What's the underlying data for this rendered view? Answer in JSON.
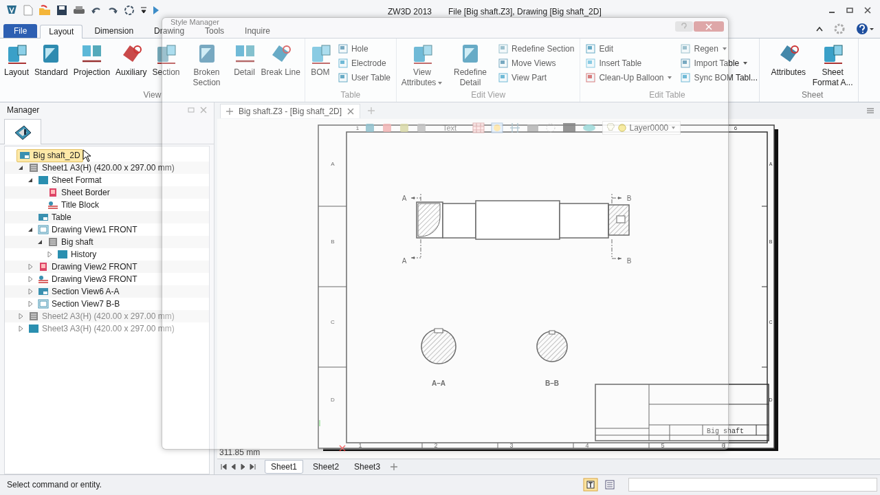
{
  "app": {
    "title": "ZW3D 2013",
    "document": "File [Big shaft.Z3],  Drawing [Big shaft_2D]"
  },
  "ribbon_tabs": [
    {
      "label": "File",
      "kind": "file",
      "selected": false
    },
    {
      "label": "Layout",
      "kind": "tab",
      "selected": true
    },
    {
      "label": "Dimension",
      "kind": "tab",
      "selected": false
    },
    {
      "label": "Drawing",
      "kind": "tab",
      "selected": false
    },
    {
      "label": "Tools",
      "kind": "tab",
      "selected": false
    },
    {
      "label": "Inquire",
      "kind": "tab",
      "selected": false
    }
  ],
  "ribbon_groups": [
    {
      "label": "View",
      "columns": [
        {
          "kind": "large",
          "items": [
            {
              "label": "Layout"
            }
          ]
        },
        {
          "kind": "large",
          "items": [
            {
              "label": "Standard"
            }
          ]
        },
        {
          "kind": "large",
          "items": [
            {
              "label": "Projection"
            }
          ]
        },
        {
          "kind": "large",
          "items": [
            {
              "label": "Auxiliary"
            }
          ]
        },
        {
          "kind": "large",
          "items": [
            {
              "label": "Section"
            }
          ]
        },
        {
          "kind": "large",
          "items": [
            {
              "label": "Broken Section"
            }
          ]
        },
        {
          "kind": "large",
          "items": [
            {
              "label": "Detail"
            }
          ]
        },
        {
          "kind": "large",
          "items": [
            {
              "label": "Break Line"
            }
          ]
        }
      ]
    },
    {
      "label": "Table",
      "columns": [
        {
          "kind": "large",
          "items": [
            {
              "label": "BOM"
            }
          ]
        },
        {
          "kind": "small",
          "items": [
            {
              "label": "Hole"
            },
            {
              "label": "Electrode"
            },
            {
              "label": "User Table"
            }
          ]
        }
      ]
    },
    {
      "label": "Edit View",
      "columns": [
        {
          "kind": "large",
          "items": [
            {
              "label": "View Attributes",
              "menu": true
            }
          ]
        },
        {
          "kind": "large",
          "items": [
            {
              "label": "Redefine Detail"
            }
          ]
        },
        {
          "kind": "small",
          "items": [
            {
              "label": "Redefine Section"
            },
            {
              "label": "Move Views"
            },
            {
              "label": "View Part"
            }
          ]
        }
      ]
    },
    {
      "label": "Edit Table",
      "columns": [
        {
          "kind": "small",
          "items": [
            {
              "label": "Edit"
            },
            {
              "label": "Insert Table"
            },
            {
              "label": "Clean-Up Balloon",
              "menu": true
            }
          ]
        },
        {
          "kind": "small",
          "items": [
            {
              "label": "Regen",
              "menu": true
            },
            {
              "label": "Import Table",
              "menu": true
            },
            {
              "label": "Sync BOM Tabl..."
            }
          ]
        }
      ]
    },
    {
      "label": "Sheet",
      "columns": [
        {
          "kind": "large",
          "items": [
            {
              "label": "Attributes"
            }
          ]
        },
        {
          "kind": "large",
          "items": [
            {
              "label": "Sheet Format A..."
            }
          ]
        }
      ]
    }
  ],
  "manager": {
    "title": "Manager",
    "tree": [
      {
        "label": "Big shaft_2D",
        "selected": true,
        "children": [
          {
            "label": "Sheet1 A3(H) (420.00 x 297.00 mm)",
            "active": true,
            "selected": false,
            "expanded": true,
            "children": [
              {
                "label": "Sheet Format",
                "selected": false,
                "expanded": true,
                "children": [
                  {
                    "label": "Sheet Border",
                    "selected": false
                  },
                  {
                    "label": "Title Block",
                    "selected": false
                  }
                ]
              },
              {
                "label": "Table",
                "selected": false
              },
              {
                "label": "Drawing View1 FRONT",
                "selected": false,
                "expanded": true,
                "children": [
                  {
                    "label": "Big shaft",
                    "selected": false,
                    "expanded": true,
                    "children": [
                      {
                        "label": "History",
                        "selected": false,
                        "expanded": false
                      }
                    ]
                  }
                ]
              },
              {
                "label": "Drawing View2 FRONT",
                "selected": false,
                "expanded": false
              },
              {
                "label": "Drawing View3 FRONT",
                "selected": false,
                "expanded": false
              },
              {
                "label": "Section View6 A-A",
                "selected": false,
                "expanded": false
              },
              {
                "label": "Section View7 B-B",
                "selected": false,
                "expanded": false
              }
            ]
          },
          {
            "label": "Sheet2 A3(H) (420.00 x 297.00 mm)",
            "active": false,
            "selected": false,
            "expanded": false
          },
          {
            "label": "Sheet3 A3(H) (420.00 x 297.00 mm)",
            "active": false,
            "selected": false,
            "expanded": false
          }
        ]
      }
    ]
  },
  "document_tab": {
    "label": "Big shaft.Z3 - [Big shaft_2D]"
  },
  "drawing_toolbar": {
    "text_label": "Text",
    "layer": "Layer0000"
  },
  "sheet": {
    "top_zones": [
      "1",
      "6"
    ],
    "bottom_zones": [
      "1",
      "2",
      "3",
      "4",
      "5",
      "6"
    ],
    "left_zones": [
      "A",
      "B",
      "C",
      "D"
    ],
    "right_zones": [
      "A",
      "B",
      "C",
      "D"
    ],
    "section_marks": [
      "A",
      "A",
      "B",
      "B"
    ],
    "section_titles": [
      "A–A",
      "B–B"
    ],
    "title_block_name": "Big shaft"
  },
  "measurement": "311.85 mm",
  "sheet_tabs": [
    {
      "label": "Sheet1",
      "selected": true
    },
    {
      "label": "Sheet2",
      "selected": false
    },
    {
      "label": "Sheet3",
      "selected": false
    }
  ],
  "status_bar": {
    "message": "Select command or entity."
  },
  "dialog": {
    "title": "Style Manager"
  }
}
